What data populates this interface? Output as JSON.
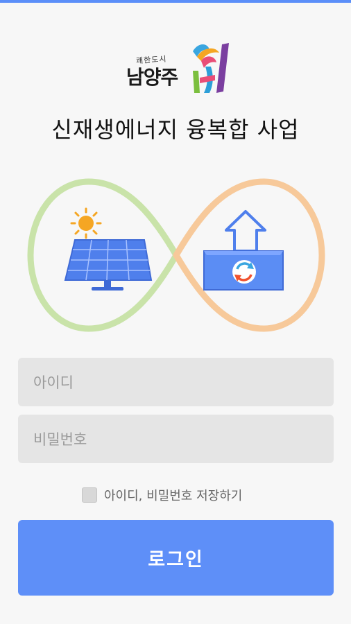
{
  "logo": {
    "slogan": "쾌한도시",
    "city_name": "남양주"
  },
  "header": {
    "title": "신재생에너지 융복합 사업"
  },
  "hero": {
    "icons": [
      "solar-panel-icon",
      "sun-icon",
      "house-icon",
      "refresh-icon",
      "infinity-loop-icon"
    ]
  },
  "login": {
    "id_placeholder": "아이디",
    "password_placeholder": "비밀번호",
    "remember_label": "아이디, 비밀번호 저장하기",
    "remember_checked": false,
    "submit_label": "로그인"
  },
  "colors": {
    "accent": "#5e8ff8",
    "loop_green": "#c9e3a9",
    "loop_orange": "#f7c99a",
    "panel_blue": "#4f7fec"
  }
}
